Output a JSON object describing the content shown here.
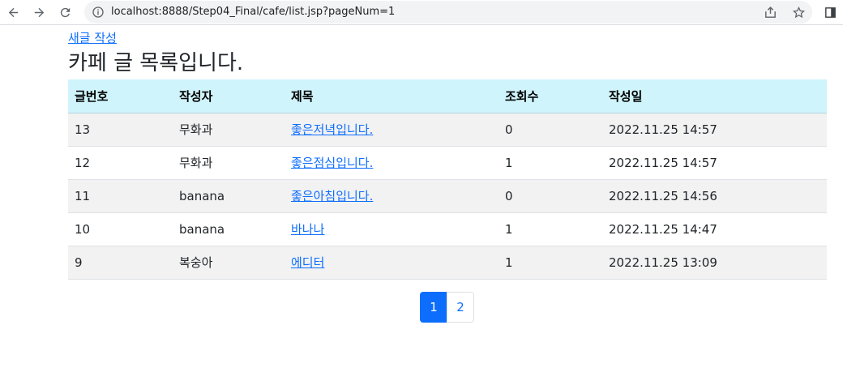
{
  "browser": {
    "url": "localhost:8888/Step04_Final/cafe/list.jsp?pageNum=1"
  },
  "page": {
    "new_post_label": "새글 작성",
    "title": "카페 글 목록입니다."
  },
  "table": {
    "headers": [
      "글번호",
      "작성자",
      "제목",
      "조회수",
      "작성일"
    ],
    "rows": [
      {
        "num": "13",
        "writer": "무화과",
        "title": "좋은저녁입니다.",
        "views": "0",
        "date": "2022.11.25 14:57"
      },
      {
        "num": "12",
        "writer": "무화과",
        "title": "좋은점심입니다.",
        "views": "1",
        "date": "2022.11.25 14:57"
      },
      {
        "num": "11",
        "writer": "banana",
        "title": "좋은아침입니다.",
        "views": "0",
        "date": "2022.11.25 14:56"
      },
      {
        "num": "10",
        "writer": "banana",
        "title": "바나나",
        "views": "1",
        "date": "2022.11.25 14:47"
      },
      {
        "num": "9",
        "writer": "복숭아",
        "title": "에디터",
        "views": "1",
        "date": "2022.11.25 13:09"
      }
    ]
  },
  "pagination": {
    "pages": [
      "1",
      "2"
    ],
    "active": "1"
  },
  "colors": {
    "link": "#0d6efd",
    "header_bg": "#cff4fc",
    "stripe_bg": "#f2f2f2"
  }
}
